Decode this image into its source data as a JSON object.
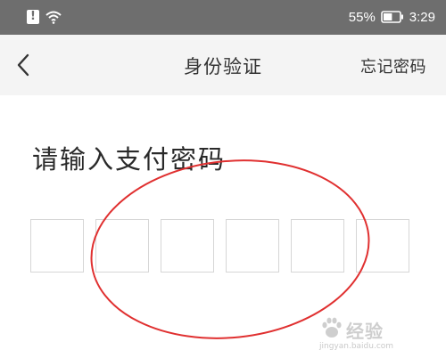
{
  "status_bar": {
    "battery_percent": "55%",
    "time": "3:29",
    "battery_level": 0.55,
    "icons": [
      "alert-icon",
      "wifi-icon",
      "battery-icon"
    ]
  },
  "nav": {
    "back_icon": "chevron-left-icon",
    "title": "身份验证",
    "forgot_label": "忘记密码"
  },
  "main": {
    "heading": "请输入支付密码",
    "pin_length": 6,
    "pin_values": [
      "",
      "",
      "",
      "",
      "",
      ""
    ]
  },
  "annotation": {
    "color": "#e03030"
  },
  "watermark": {
    "brand": "经验",
    "domain": "jingyan.baidu.com"
  },
  "colors": {
    "status_bar_bg": "#6e6e6e",
    "nav_bg": "#f4f4f4",
    "box_border": "#d6d6d6"
  }
}
